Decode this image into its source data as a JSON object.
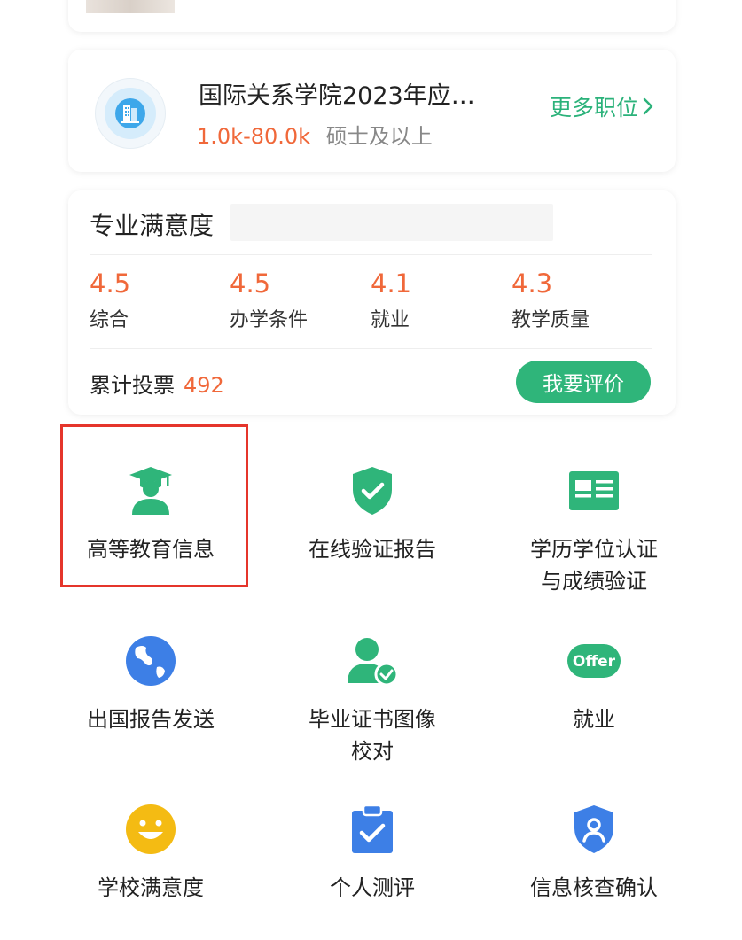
{
  "job": {
    "title": "国际关系学院2023年应…",
    "salary": "1.0k-80.0k",
    "degree": "硕士及以上",
    "more_label": "更多职位",
    "more_icon": "chevron-right-icon"
  },
  "rating": {
    "title": "专业满意度",
    "scores": [
      {
        "value": "4.5",
        "label": "综合"
      },
      {
        "value": "4.5",
        "label": "办学条件"
      },
      {
        "value": "4.1",
        "label": "就业"
      },
      {
        "value": "4.3",
        "label": "教学质量"
      }
    ],
    "votes_label": "累计投票",
    "votes_count": "492",
    "rate_button": "我要评价"
  },
  "grid": [
    {
      "label": "高等教育信息",
      "icon": "graduate-icon"
    },
    {
      "label": "在线验证报告",
      "icon": "shield-check-icon"
    },
    {
      "label": "学历学位认证\n与成绩验证",
      "icon": "id-card-icon"
    },
    {
      "label": "出国报告发送",
      "icon": "globe-icon"
    },
    {
      "label": "毕业证书图像\n校对",
      "icon": "user-check-icon"
    },
    {
      "label": "就业",
      "icon": "offer-icon",
      "icon_text": "Offer"
    },
    {
      "label": "学校满意度",
      "icon": "smiley-icon"
    },
    {
      "label": "个人测评",
      "icon": "clipboard-check-icon"
    },
    {
      "label": "信息核查确认",
      "icon": "shield-user-icon"
    }
  ],
  "colors": {
    "accent_green": "#2fb57a",
    "accent_orange": "#f0683a",
    "icon_blue": "#3d7fe6",
    "icon_yellow": "#f4bb13",
    "highlight_red": "#e5352b"
  }
}
